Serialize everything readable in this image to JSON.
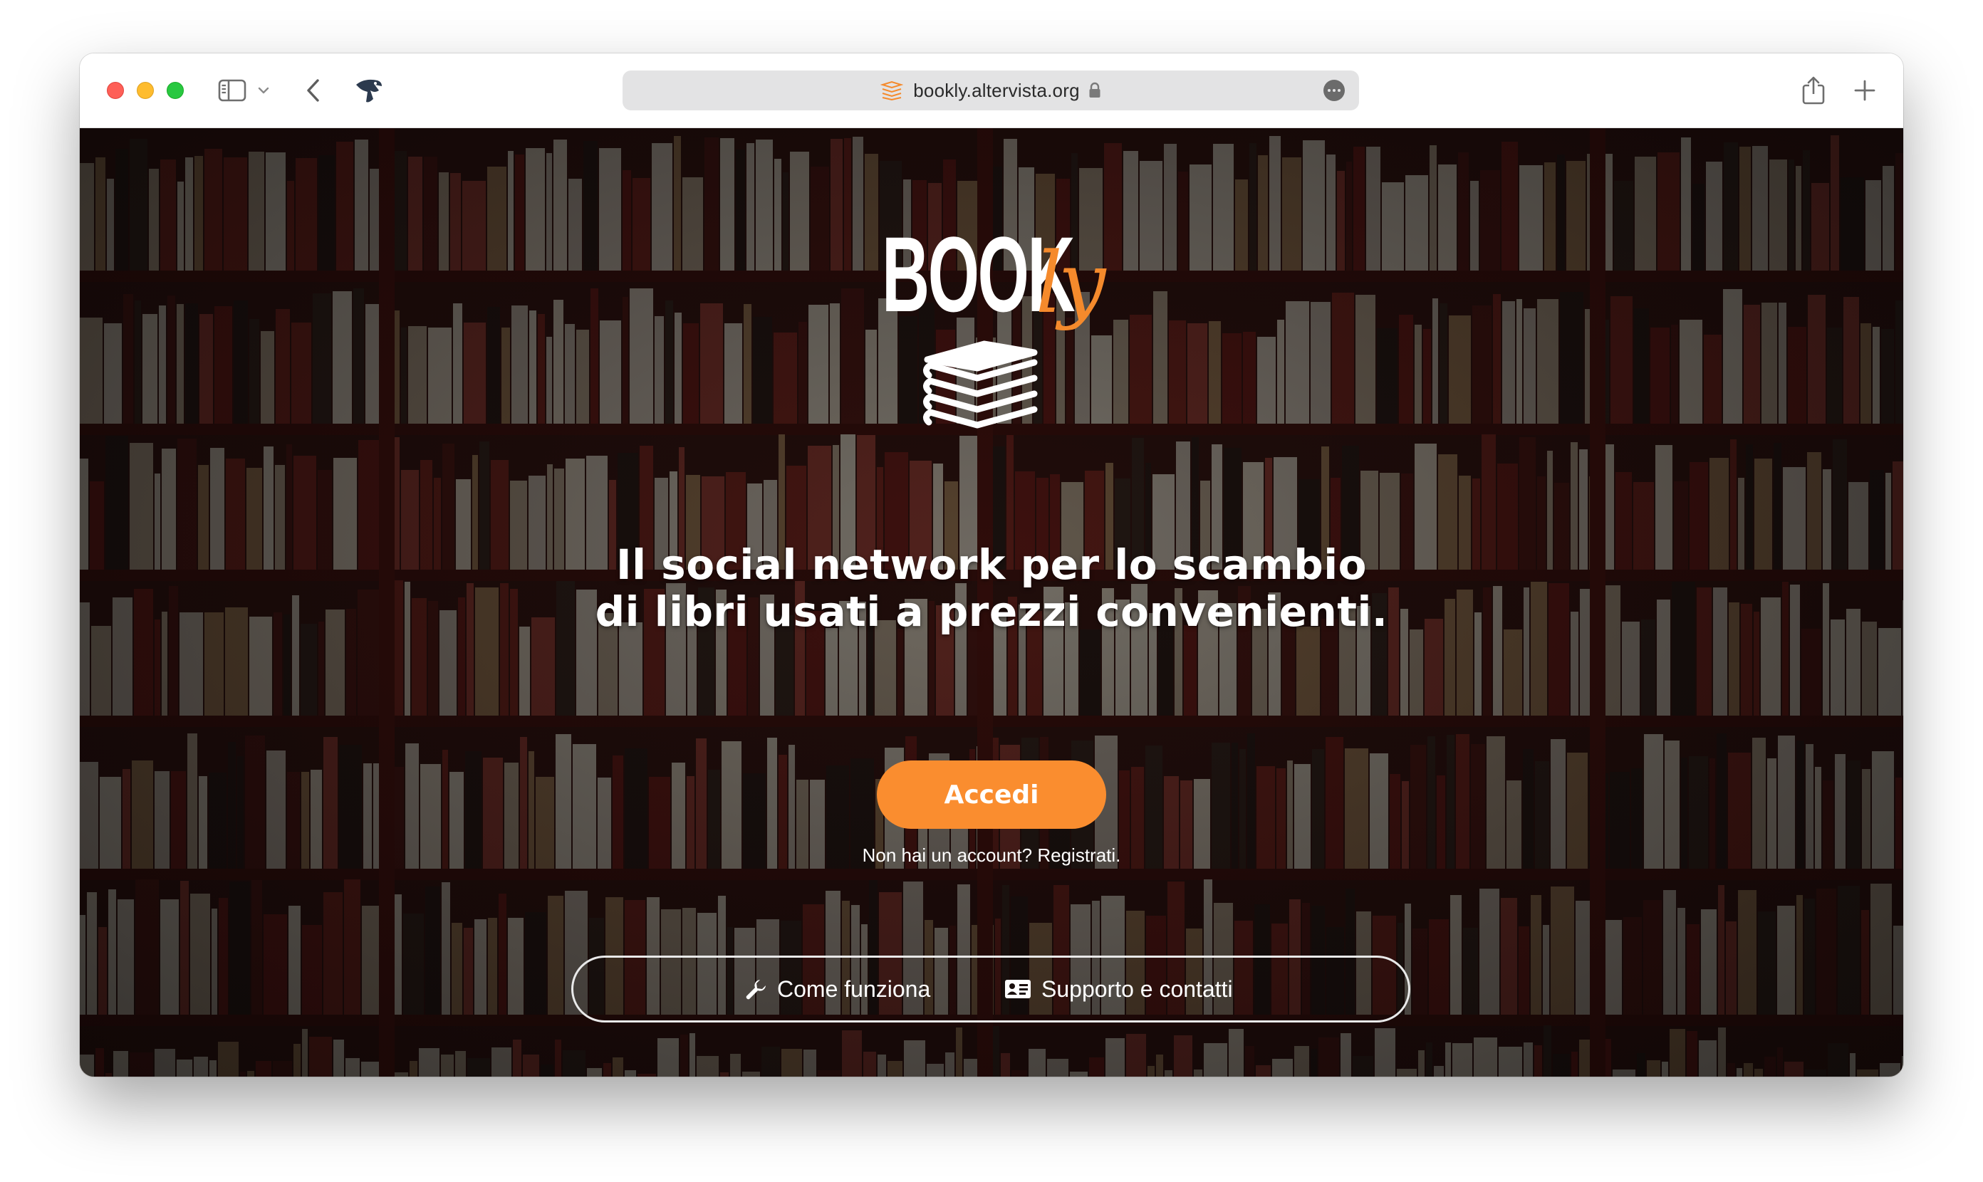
{
  "browser": {
    "url": "bookly.altervista.org",
    "icons": {
      "sidebar": "sidebar-toggle-icon",
      "back": "back-arrow-icon",
      "extension": "extension-icon",
      "share": "share-icon",
      "new_tab": "plus-icon",
      "lock": "lock-icon",
      "more": "ellipsis-icon"
    }
  },
  "logo": {
    "word": "BOOK",
    "accent": "ly"
  },
  "hero": {
    "headline_line1": "Il social network per lo scambio",
    "headline_line2": "di libri usati a prezzi convenienti.",
    "cta_label": "Accedi",
    "signup_prompt": "Non hai un account?",
    "signup_link": "Registrati."
  },
  "footer_links": {
    "how_it_works": "Come funziona",
    "support": "Supporto e contatti"
  },
  "colors": {
    "accent": "#fa8d2f",
    "background_overlay": "#140a08",
    "text": "#ffffff"
  }
}
